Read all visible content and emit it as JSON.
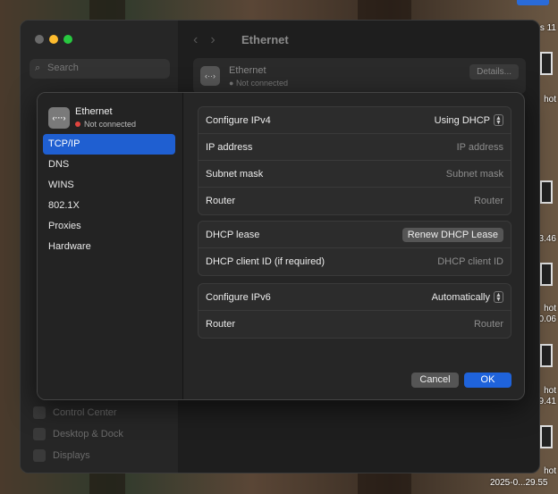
{
  "desktop": {
    "right_labels": [
      "s 11",
      "hot",
      "3.46",
      "hot",
      "0.06",
      "hot",
      "9.41",
      "hot"
    ],
    "bottom_stamp": "2025-0...29.55"
  },
  "window": {
    "title": "Ethernet",
    "search_placeholder": "Search",
    "nav_back": "‹",
    "nav_forward": "›",
    "sidebar_dim_items": [
      "Control Center",
      "Desktop & Dock",
      "Displays"
    ],
    "service": {
      "name": "Ethernet",
      "status": "Not connected",
      "details_label": "Details..."
    }
  },
  "sheet": {
    "header": {
      "name": "Ethernet",
      "status": "Not connected",
      "icon_glyph": "‹···›"
    },
    "sidebar_items": [
      "TCP/IP",
      "DNS",
      "WINS",
      "802.1X",
      "Proxies",
      "Hardware"
    ],
    "active_item": "TCP/IP",
    "ipv4": {
      "configure_label": "Configure IPv4",
      "configure_value": "Using DHCP",
      "ip_label": "IP address",
      "ip_placeholder": "IP address",
      "subnet_label": "Subnet mask",
      "subnet_placeholder": "Subnet mask",
      "router_label": "Router",
      "router_placeholder": "Router"
    },
    "dhcp": {
      "lease_label": "DHCP lease",
      "renew_button": "Renew DHCP Lease",
      "client_id_label": "DHCP client ID (if required)",
      "client_id_placeholder": "DHCP client ID"
    },
    "ipv6": {
      "configure_label": "Configure IPv6",
      "configure_value": "Automatically",
      "router_label": "Router",
      "router_placeholder": "Router"
    },
    "buttons": {
      "cancel": "Cancel",
      "ok": "OK"
    }
  },
  "colors": {
    "accent": "#1f5fd1",
    "status_red": "#e0443e",
    "traffic_red": "#ff5f57",
    "traffic_yellow": "#febc2e",
    "traffic_green": "#28c840"
  }
}
